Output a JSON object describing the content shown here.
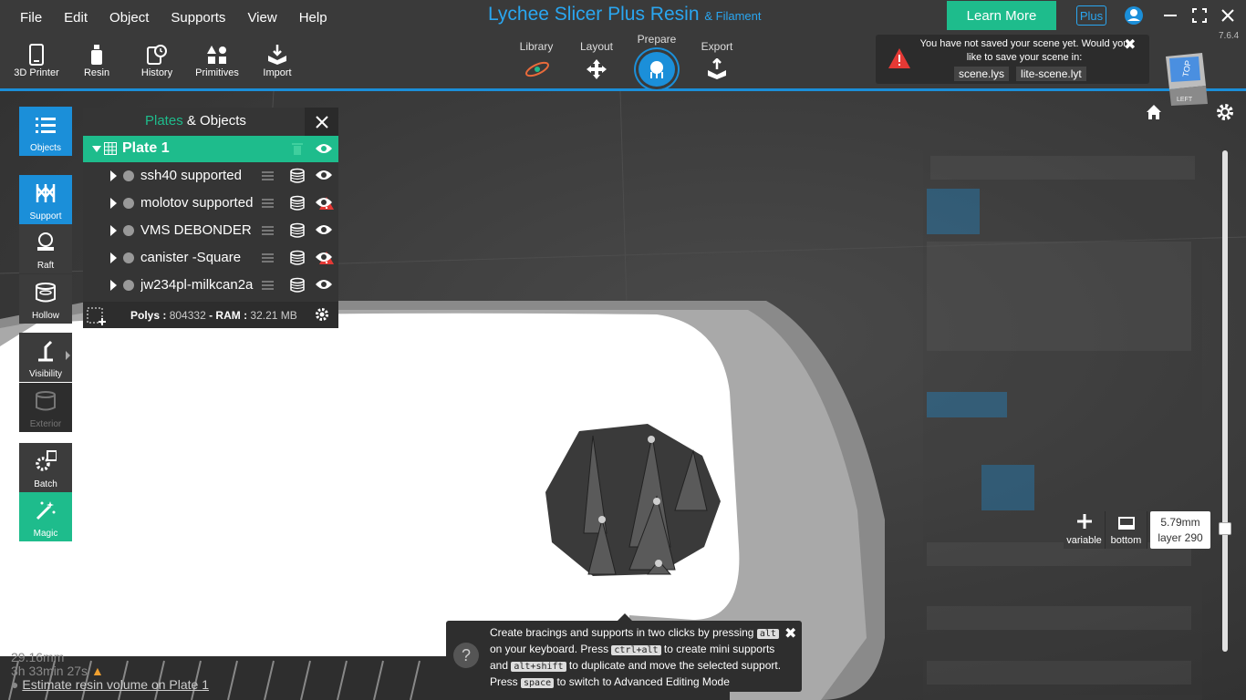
{
  "menu": [
    "File",
    "Edit",
    "Object",
    "Supports",
    "View",
    "Help"
  ],
  "app": {
    "title": "Lychee Slicer Plus Resin",
    "title_suffix": "& Filament",
    "version": "7.6.4",
    "learn_more": "Learn More",
    "plus_badge": "Plus"
  },
  "toolbar": [
    {
      "label": "3D Printer",
      "icon": "printer-icon"
    },
    {
      "label": "Resin",
      "icon": "resin-bottle-icon"
    },
    {
      "label": "History",
      "icon": "history-icon"
    },
    {
      "label": "Primitives",
      "icon": "primitives-icon"
    },
    {
      "label": "Import",
      "icon": "import-icon"
    }
  ],
  "tabs": {
    "library": "Library",
    "layout": "Layout",
    "prepare": "Prepare",
    "export": "Export"
  },
  "save_notice": {
    "message": "You have not saved your scene yet. Would you like to save your scene in:",
    "option1": "scene.lys",
    "option2": "lite-scene.lyt"
  },
  "viewcube": {
    "top": "TOP",
    "left": "LEFT"
  },
  "sidebar": {
    "objects": "Objects",
    "support": "Support",
    "raft": "Raft",
    "hollow": "Hollow",
    "visibility": "Visibility",
    "exterior": "Exterior",
    "batch": "Batch",
    "magic": "Magic"
  },
  "panel": {
    "title_a": "Plates",
    "title_amp": " & ",
    "title_b": "Objects",
    "plate": "Plate 1",
    "objects": [
      {
        "name": "ssh40 supported",
        "error": false
      },
      {
        "name": "molotov supported",
        "error": true
      },
      {
        "name": "VMS DEBONDER HOLDER",
        "error": false
      },
      {
        "name": "canister -Square",
        "error": true
      },
      {
        "name": "jw234pl-milkcan2a",
        "error": false
      }
    ],
    "polys_label": "Polys :",
    "polys_value": "804332",
    "ram_label": " - RAM :",
    "ram_value": "32.21 MB"
  },
  "layer": {
    "variable": "variable",
    "bottom": "bottom",
    "height": "5.79mm",
    "layer": "layer 290"
  },
  "tip": {
    "p1": "Create bracings and supports in two clicks by pressing ",
    "k1": "alt",
    "p2": " on your keyboard. Press ",
    "k2": "ctrl+alt",
    "p3": " to create mini supports and ",
    "k3": "alt+shift",
    "p4": " to duplicate and move the selected support. Press ",
    "k4": "space",
    "p5": " to switch to Advanced Editing Mode"
  },
  "bottom_info": {
    "height": "29.16mm",
    "time": "3h 33min 27s",
    "estimate_link": "Estimate resin volume on Plate 1"
  },
  "colors": {
    "accent_blue": "#1b8fd9",
    "accent_green": "#1ebc8c",
    "title_blue": "#2aa6f0",
    "warning_red": "#e53935"
  }
}
